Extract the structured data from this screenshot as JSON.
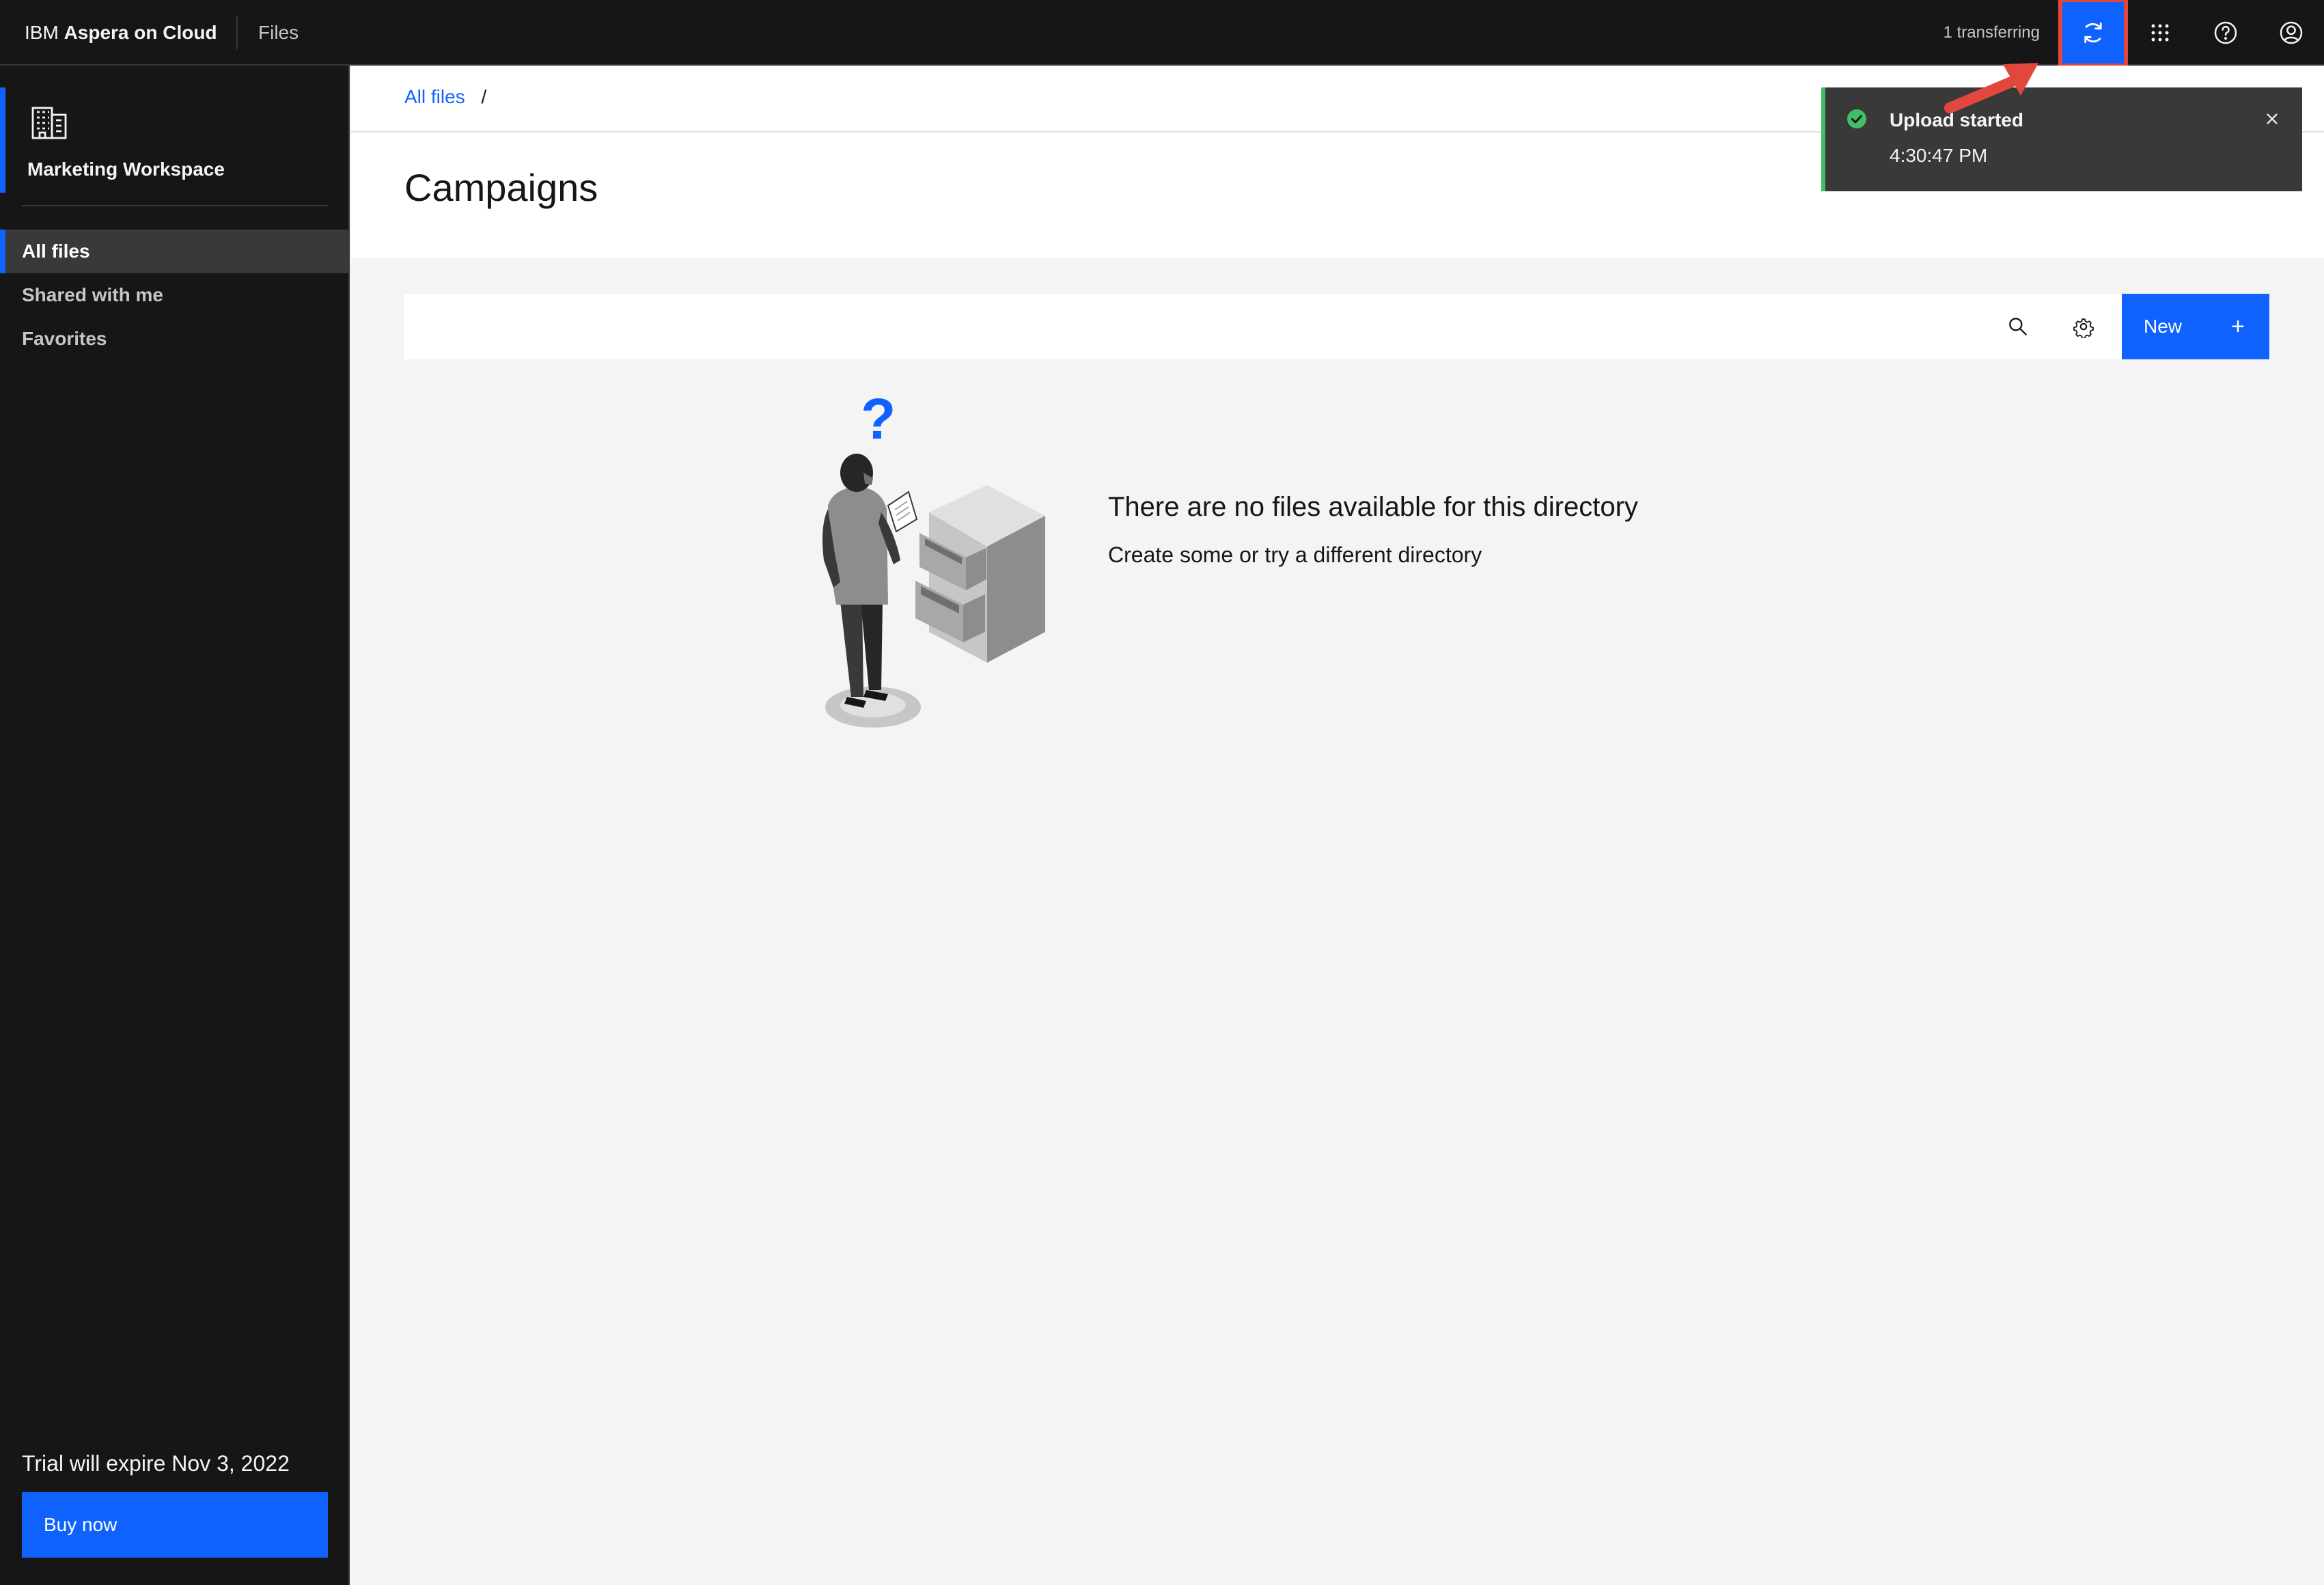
{
  "header": {
    "brand_prefix": "IBM",
    "brand_name": "Aspera on Cloud",
    "section": "Files",
    "transfer_status": "1 transferring",
    "icons": [
      "transfers-icon",
      "app-switcher-icon",
      "help-icon",
      "user-icon"
    ],
    "accent_color": "#0f62fe",
    "highlight_color": "#e2473d"
  },
  "sidebar": {
    "workspace_icon": "building-icon",
    "workspace_name": "Marketing Workspace",
    "items": [
      {
        "label": "All files",
        "active": true
      },
      {
        "label": "Shared with me",
        "active": false
      },
      {
        "label": "Favorites",
        "active": false
      }
    ],
    "trial_text": "Trial will expire Nov 3, 2022",
    "buy_label": "Buy now"
  },
  "breadcrumb": {
    "root": "All files",
    "separator": "/"
  },
  "page": {
    "title": "Campaigns"
  },
  "toolbar": {
    "search_icon": "search-icon",
    "settings_icon": "settings-icon",
    "new_label": "New",
    "new_icon": "+"
  },
  "empty_state": {
    "title": "There are no files available for this directory",
    "subtitle": "Create some or try a different directory"
  },
  "toast": {
    "status": "success",
    "status_color": "#42be65",
    "title": "Upload started",
    "time": "4:30:47 PM"
  }
}
